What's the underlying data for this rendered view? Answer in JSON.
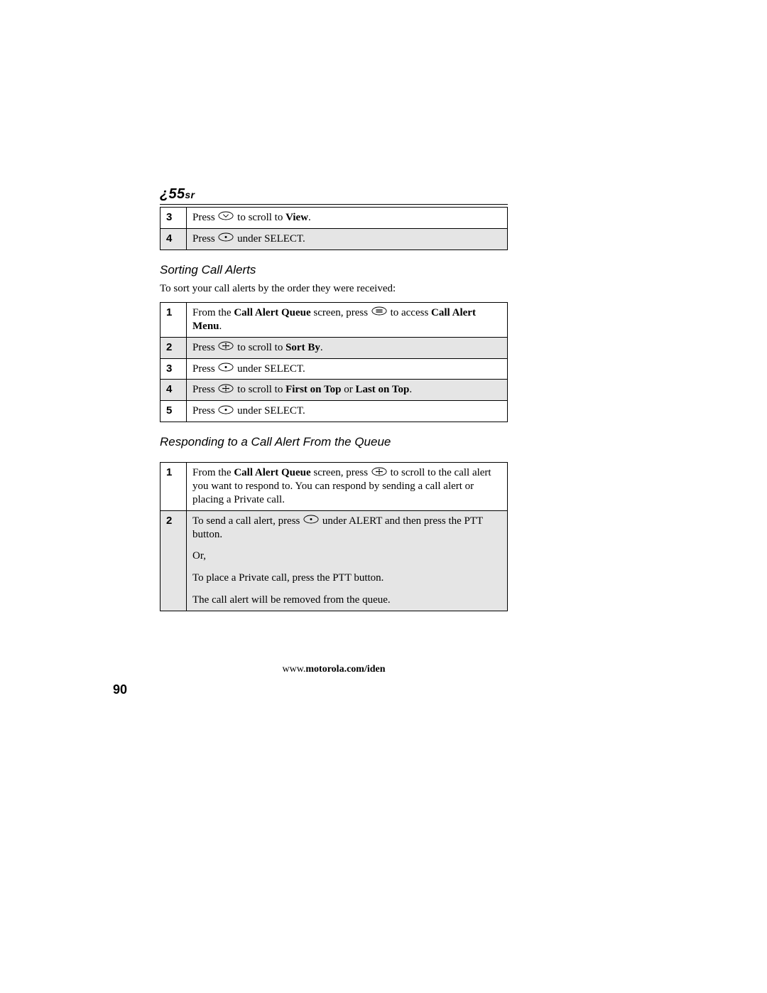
{
  "header": {
    "logo_main": "55",
    "logo_suffix": "sr"
  },
  "table1": {
    "rows": [
      {
        "num": "3",
        "parts": [
          "Press ",
          " to scroll to ",
          "View",
          "."
        ],
        "bold_idx": [
          2
        ],
        "icon_after": 0
      },
      {
        "num": "4",
        "parts": [
          "Press ",
          " under SELECT."
        ],
        "icon_after": 0
      }
    ]
  },
  "section1": {
    "title": "Sorting Call Alerts",
    "intro": "To sort your call alerts by the order they were received:"
  },
  "table2": {
    "rows": [
      {
        "num": "1",
        "parts": [
          "From the ",
          "Call Alert Queue",
          " screen, press ",
          " to access ",
          "Call Alert Menu",
          "."
        ],
        "bold_idx": [
          1,
          4
        ],
        "icon_after": 2
      },
      {
        "num": "2",
        "parts": [
          "Press ",
          " to scroll to ",
          "Sort By",
          "."
        ],
        "bold_idx": [
          2
        ],
        "icon_after": 0
      },
      {
        "num": "3",
        "parts": [
          "Press ",
          " under SELECT."
        ],
        "icon_after": 0
      },
      {
        "num": "4",
        "parts": [
          "Press ",
          " to scroll to ",
          "First on Top",
          " or ",
          "Last on Top",
          "."
        ],
        "bold_idx": [
          2,
          4
        ],
        "icon_after": 0
      },
      {
        "num": "5",
        "parts": [
          "Press ",
          " under SELECT."
        ],
        "icon_after": 0
      }
    ]
  },
  "section2": {
    "title": "Responding to a Call Alert From the Queue"
  },
  "table3": {
    "rows": [
      {
        "num": "1",
        "parts": [
          "From the ",
          "Call Alert Queue",
          " screen, press ",
          " to scroll to the call alert you want to respond to. You can respond by sending a call alert or placing a Private call."
        ],
        "bold_idx": [
          1
        ],
        "icon_after": 2
      },
      {
        "num": "2",
        "paragraphs": [
          {
            "parts": [
              "To send a call alert, press ",
              " under ALERT and then press the PTT button."
            ],
            "icon_after": 0
          },
          {
            "parts": [
              "Or,"
            ]
          },
          {
            "parts": [
              "To place a Private call, press the PTT button."
            ]
          },
          {
            "parts": [
              "The call alert will be removed from the queue."
            ]
          }
        ]
      }
    ]
  },
  "footer": {
    "url_prefix": "www.",
    "url_bold": "motorola.com/iden"
  },
  "page_number": "90",
  "icons": {
    "nav_down": "nav-down",
    "nav_4way": "nav-4way",
    "soft_dot": "soft-dot",
    "menu_key": "menu-key"
  }
}
